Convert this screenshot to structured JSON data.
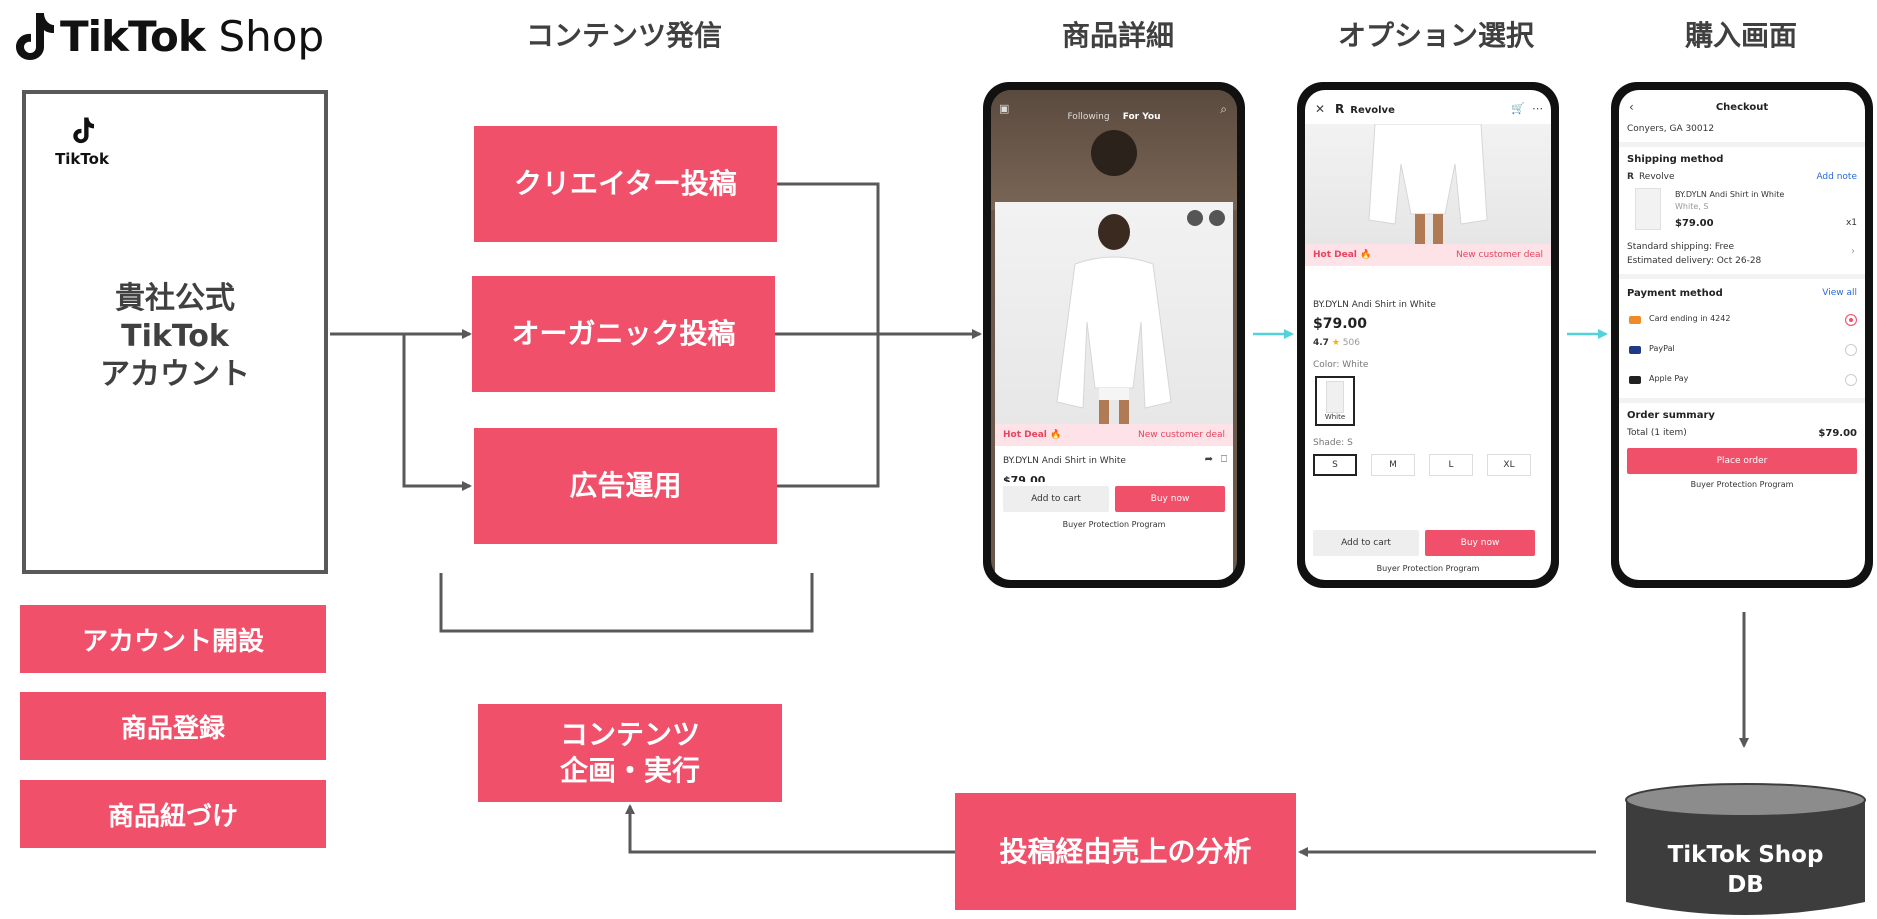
{
  "brand": {
    "logo_text": "TikTok",
    "logo_suffix": "Shop"
  },
  "headers": {
    "content": "コンテンツ発信",
    "product_detail": "商品詳細",
    "option_select": "オプション選択",
    "purchase": "購入画面"
  },
  "account": {
    "mini_logo_text": "TikTok",
    "title": "貴社公式\nTikTok\nアカウント"
  },
  "setup_steps": [
    "アカウント開設",
    "商品登録",
    "商品紐づけ"
  ],
  "content_channels": [
    "クリエイター投稿",
    "オーガニック投稿",
    "広告運用"
  ],
  "planning_box": "コンテンツ\n企画・実行",
  "analysis_box": "投稿経由売上の分析",
  "database": "TikTok Shop\nDB",
  "phone1": {
    "tabs": [
      "Following",
      "For You"
    ],
    "deal_left": "Hot Deal 🔥",
    "deal_right": "New customer deal",
    "product_name": "BY.DYLN Andi Shirt in White",
    "price_partial": "$79.00",
    "add_to_cart": "Add to cart",
    "buy_now": "Buy now",
    "protection": "Buyer Protection Program"
  },
  "phone2": {
    "shop_name": "Revolve",
    "deal_left": "Hot Deal 🔥",
    "deal_right": "New customer deal",
    "product_name": "BY.DYLN Andi Shirt in White",
    "price": "$79.00",
    "rating": "4.7",
    "rating_count": "506",
    "color_label": "Color: White",
    "color_swatch_label": "White",
    "shade_label": "Shade: S",
    "shades": [
      "S",
      "M",
      "L",
      "XL"
    ],
    "add_to_cart": "Add to cart",
    "buy_now": "Buy now",
    "protection": "Buyer Protection Program"
  },
  "phone3": {
    "title": "Checkout",
    "address_line": "Conyers, GA 30012",
    "shipping_heading": "Shipping method",
    "shop_name": "Revolve",
    "add_note": "Add note",
    "item_name": "BY.DYLN Andi Shirt in White",
    "item_variant": "White, S",
    "item_price": "$79.00",
    "item_qty": "x1",
    "shipping_line": "Standard shipping: Free",
    "delivery_line": "Estimated delivery: Oct 26-28",
    "payment_heading": "Payment method",
    "view_all": "View all",
    "payment_options": [
      "Card ending in 4242",
      "PayPal",
      "Apple Pay"
    ],
    "summary_heading": "Order summary",
    "total_label": "Total (1 item)",
    "total_value": "$79.00",
    "place_order": "Place order",
    "protection": "Buyer Protection Program"
  },
  "colors": {
    "accent_pink": "#f0506a",
    "arrow_gray": "#595959",
    "arrow_cyan": "#52d3dc",
    "db_dark": "#3d3d3d"
  }
}
